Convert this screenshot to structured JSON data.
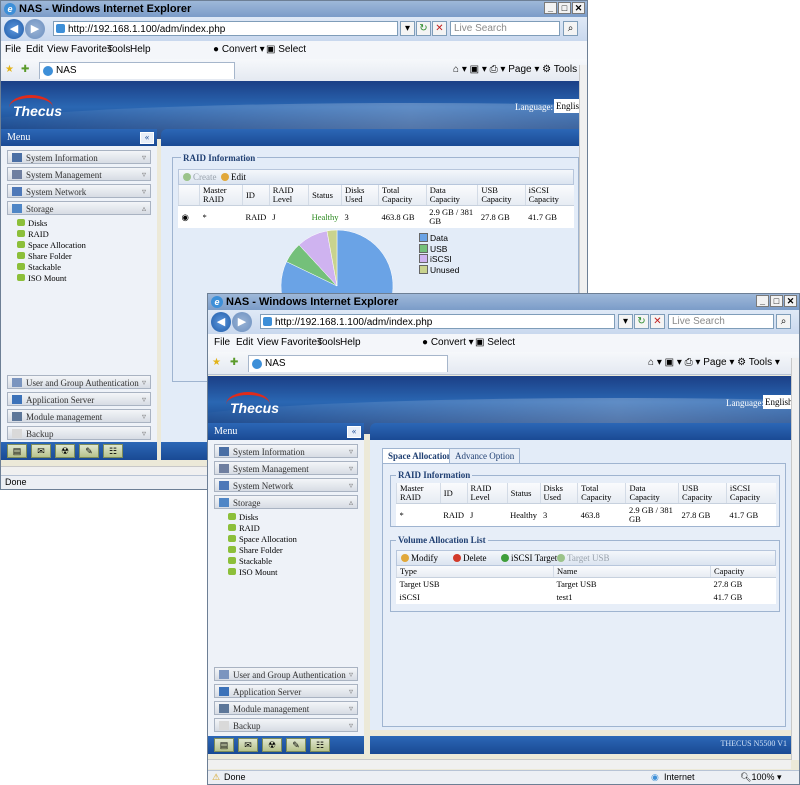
{
  "back_window": {
    "title": "NAS - Windows Internet Explorer",
    "url": "http://192.168.1.100/adm/index.php",
    "search_placeholder": "Live Search",
    "menu": [
      "File",
      "Edit",
      "View",
      "Favorites",
      "Tools",
      "Help"
    ],
    "convert_label": "Convert",
    "select_label": "Select",
    "tab_label": "NAS",
    "cmd": {
      "page": "Page",
      "tools": "Tools"
    },
    "language_label": "Language:",
    "language_value": "English",
    "logo": "Thecus",
    "menu_title": "Menu",
    "sidebar": {
      "system_information": "System Information",
      "system_management": "System Management",
      "system_network": "System Network",
      "storage": "Storage",
      "storage_items": [
        "Disks",
        "RAID",
        "Space Allocation",
        "Share Folder",
        "Stackable",
        "ISO Mount"
      ],
      "user_group_auth": "User and Group Authentication",
      "application_server": "Application Server",
      "module_management": "Module management",
      "backup": "Backup"
    },
    "raid_panel": {
      "legend": "RAID Information",
      "create_label": "Create",
      "edit_label": "Edit",
      "headers": [
        "Master RAID",
        "ID",
        "RAID Level",
        "Status",
        "Disks Used",
        "Total Capacity",
        "Data Capacity",
        "USB Capacity",
        "iSCSI Capacity"
      ],
      "row": [
        "*",
        "RAID",
        "J",
        "Healthy",
        "3",
        "463.8 GB",
        "2.9 GB / 381 GB",
        "27.8 GB",
        "41.7 GB"
      ],
      "selected_radio": true
    },
    "status_text": "Done"
  },
  "chart_data": {
    "type": "pie",
    "title": "",
    "categories": [
      "Data",
      "USB",
      "iSCSI",
      "Unused"
    ],
    "values": [
      381,
      27.8,
      41.7,
      13.3
    ],
    "colors": [
      "#6aa3e6",
      "#74c07a",
      "#cfb3f0",
      "#c9d38e"
    ]
  },
  "front_window": {
    "title": "NAS - Windows Internet Explorer",
    "url": "http://192.168.1.100/adm/index.php",
    "search_placeholder": "Live Search",
    "menu": [
      "File",
      "Edit",
      "View",
      "Favorites",
      "Tools",
      "Help"
    ],
    "convert_label": "Convert",
    "select_label": "Select",
    "tab_label": "NAS",
    "cmd": {
      "page": "Page",
      "tools": "Tools"
    },
    "language_label": "Language:",
    "language_value": "English",
    "logo": "Thecus",
    "menu_title": "Menu",
    "sidebar": {
      "system_information": "System Information",
      "system_management": "System Management",
      "system_network": "System Network",
      "storage": "Storage",
      "storage_items": [
        "Disks",
        "RAID",
        "Space Allocation",
        "Share Folder",
        "Stackable",
        "ISO Mount"
      ],
      "user_group_auth": "User and Group Authentication",
      "application_server": "Application Server",
      "module_management": "Module management",
      "backup": "Backup"
    },
    "tabs": [
      "Space Allocation",
      "Advance Option"
    ],
    "raid_panel": {
      "legend": "RAID Information",
      "headers": [
        "Master RAID",
        "ID",
        "RAID Level",
        "Status",
        "Disks Used",
        "Total Capacity",
        "Data Capacity",
        "USB Capacity",
        "iSCSI Capacity"
      ],
      "row": [
        "*",
        "RAID",
        "J",
        "Healthy",
        "3",
        "463.8",
        "2.9 GB / 381 GB",
        "27.8 GB",
        "41.7 GB"
      ]
    },
    "volume_panel": {
      "legend": "Volume Allocation List",
      "modify_label": "Modify",
      "delete_label": "Delete",
      "iscsi_target_label": "iSCSI Target",
      "target_usb_label": "Target USB",
      "headers": [
        "Type",
        "Name",
        "Capacity"
      ],
      "rows": [
        [
          "Target USB",
          "Target USB",
          "27.8 GB"
        ],
        [
          "iSCSI",
          "test1",
          "41.7 GB"
        ]
      ]
    },
    "footer_brand": "THECUS N5500 V1",
    "status_text": "Done",
    "zone_text": "Internet",
    "zoom": "100%"
  }
}
